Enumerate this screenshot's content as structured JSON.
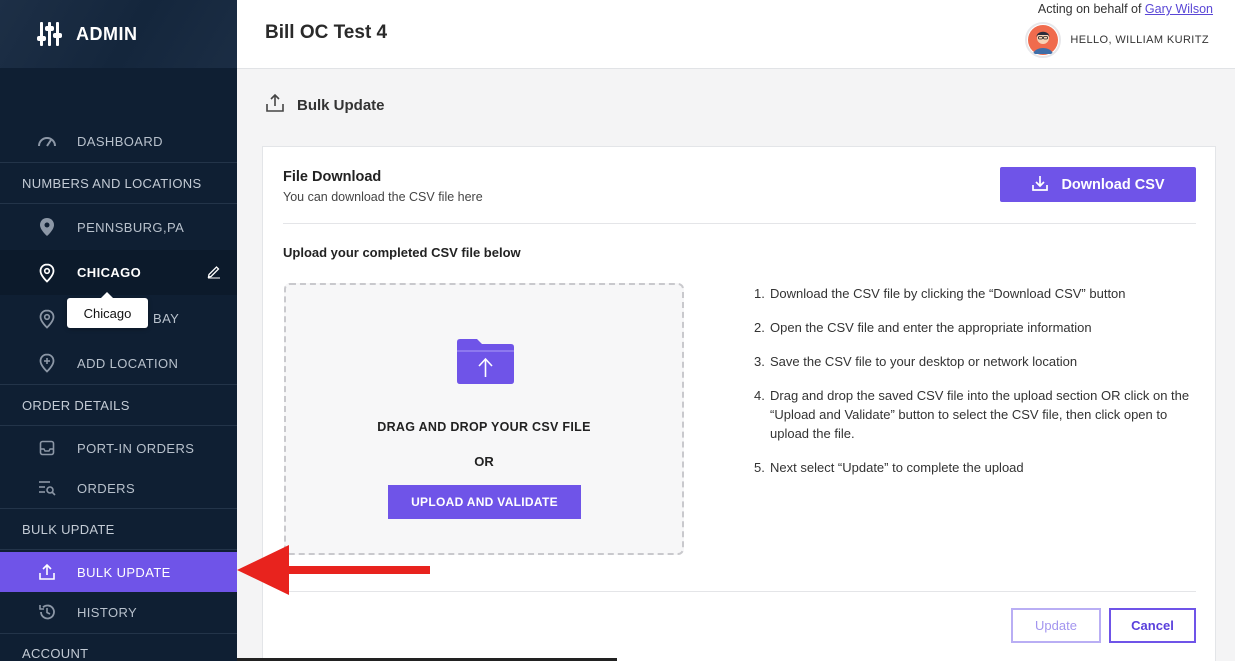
{
  "app": {
    "brand": "ADMIN"
  },
  "header": {
    "title": "Bill OC Test 4",
    "acting_prefix": "Acting on behalf of",
    "acting_user": "Gary Wilson",
    "greeting": "HELLO, WILLIAM KURITZ"
  },
  "sidebar": {
    "dashboard": "DASHBOARD",
    "sections": {
      "numbers": "NUMBERS AND LOCATIONS",
      "orders": "ORDER DETAILS",
      "bulk": "BULK UPDATE",
      "account": "ACCOUNT"
    },
    "locations": [
      "PENNSBURG,PA",
      "CHICAGO",
      "BAY"
    ],
    "add_location": "ADD LOCATION",
    "port_in": "PORT-IN ORDERS",
    "orders": "ORDERS",
    "bulk_update": "BULK UPDATE",
    "history": "HISTORY",
    "tooltip": "Chicago"
  },
  "page": {
    "subtitle": "Bulk Update",
    "file_download": {
      "title": "File Download",
      "subtitle": "You can download the CSV file here",
      "button": "Download CSV"
    },
    "upload": {
      "title": "Upload your completed CSV file below",
      "drop_text": "DRAG AND DROP YOUR CSV FILE",
      "or": "OR",
      "button": "UPLOAD AND VALIDATE"
    },
    "steps": [
      {
        "num": "1.",
        "text": "Download the CSV file by clicking the “Download CSV” button"
      },
      {
        "num": "2.",
        "text": "Open the CSV file and enter the appropriate information"
      },
      {
        "num": "3.",
        "text": "Save the CSV file to your desktop or network location"
      },
      {
        "num": "4.",
        "text": "Drag and drop the saved CSV file into the upload section OR click on the “Upload and Validate” button to select the CSV file, then click open to upload the file."
      },
      {
        "num": "5.",
        "text": "Next select “Update” to complete the upload"
      }
    ],
    "actions": {
      "update": "Update",
      "cancel": "Cancel"
    }
  },
  "colors": {
    "accent": "#6f54e8",
    "sidebar": "#0f1f33",
    "annotation_arrow": "#e8231e"
  }
}
